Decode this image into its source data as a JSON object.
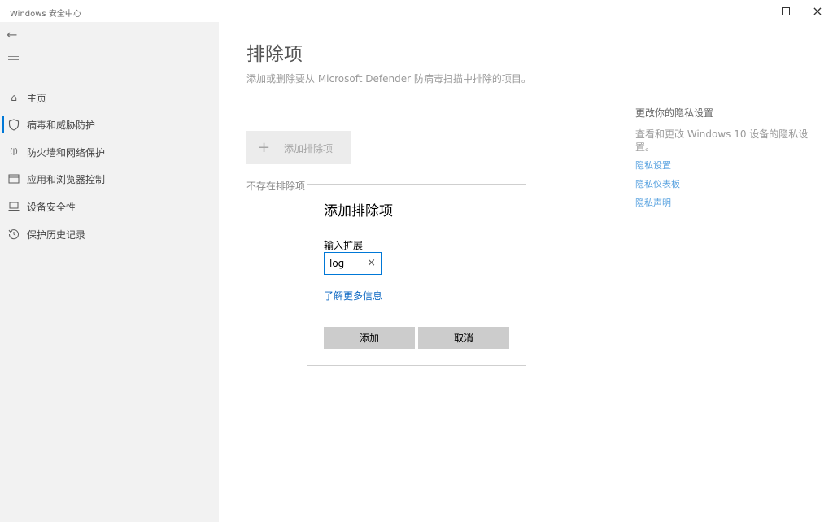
{
  "window": {
    "title": "Windows 安全中心",
    "controls": {
      "minimize": "minimize-icon",
      "maximize": "maximize-icon",
      "close": "×"
    }
  },
  "sidebar": {
    "back_icon": "←",
    "items": [
      {
        "label": "主页",
        "icon": "⌂"
      },
      {
        "label": "病毒和威胁防护",
        "icon": "shield-icon",
        "active": true
      },
      {
        "label": "防火墙和网络保护",
        "icon": "(ǀ)"
      },
      {
        "label": "应用和浏览器控制",
        "icon": "app-window-icon"
      },
      {
        "label": "设备安全性",
        "icon": "laptop-icon"
      },
      {
        "label": "保护历史记录",
        "icon": "history-icon"
      }
    ]
  },
  "main": {
    "title": "排除项",
    "subtitle": "添加或删除要从 Microsoft Defender 防病毒扫描中排除的项目。",
    "add_button": {
      "icon": "+",
      "label": "添加排除项"
    },
    "empty_text": "不存在排除项"
  },
  "privacy": {
    "heading": "更改你的隐私设置",
    "description": "查看和更改 Windows 10 设备的隐私设置。",
    "links": [
      "隐私设置",
      "隐私仪表板",
      "隐私声明"
    ]
  },
  "dialog": {
    "title": "添加排除项",
    "field_label": "输入扩展",
    "field_value": "log",
    "clear_icon": "×",
    "learn_more": "了解更多信息",
    "add_label": "添加",
    "cancel_label": "取消"
  },
  "colors": {
    "accent": "#0078d7",
    "sidebar_bg": "#f2f2f2",
    "link": "#0a66c2"
  }
}
